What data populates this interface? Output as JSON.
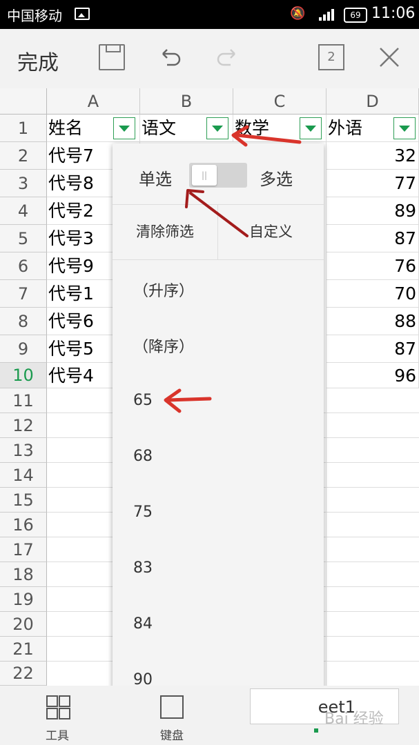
{
  "status_bar": {
    "carrier": "中国移动",
    "battery": "69",
    "time": "11:06"
  },
  "toolbar": {
    "done_label": "完成",
    "pages_count": "2"
  },
  "sheet": {
    "columns": [
      "A",
      "B",
      "C",
      "D"
    ],
    "rows": [
      "1",
      "2",
      "3",
      "4",
      "5",
      "6",
      "7",
      "8",
      "9",
      "10",
      "11",
      "12",
      "13",
      "14",
      "15",
      "16",
      "17",
      "18",
      "19",
      "20",
      "21",
      "22"
    ],
    "active_row": "10",
    "headers": [
      "姓名",
      "语文",
      "数学",
      "外语"
    ],
    "names": [
      "代号7",
      "代号8",
      "代号2",
      "代号3",
      "代号9",
      "代号1",
      "代号6",
      "代号5",
      "代号4"
    ],
    "foreign_scores": [
      "32",
      "77",
      "89",
      "87",
      "76",
      "70",
      "88",
      "87",
      "96"
    ]
  },
  "filter_popup": {
    "single_label": "单选",
    "multi_label": "多选",
    "clear_label": "清除筛选",
    "custom_label": "自定义",
    "sort_asc": "（升序）",
    "sort_desc": "（降序）",
    "values": [
      "65",
      "68",
      "75",
      "83",
      "84",
      "90"
    ]
  },
  "bottom_bar": {
    "tools_label": "工具",
    "keyboard_label": "键盘",
    "sheet_tab_label": "eet1",
    "watermark": "Bai 经验"
  },
  "colors": {
    "accent": "#1a9a4e",
    "annotation_arrow": "#d9342b"
  }
}
